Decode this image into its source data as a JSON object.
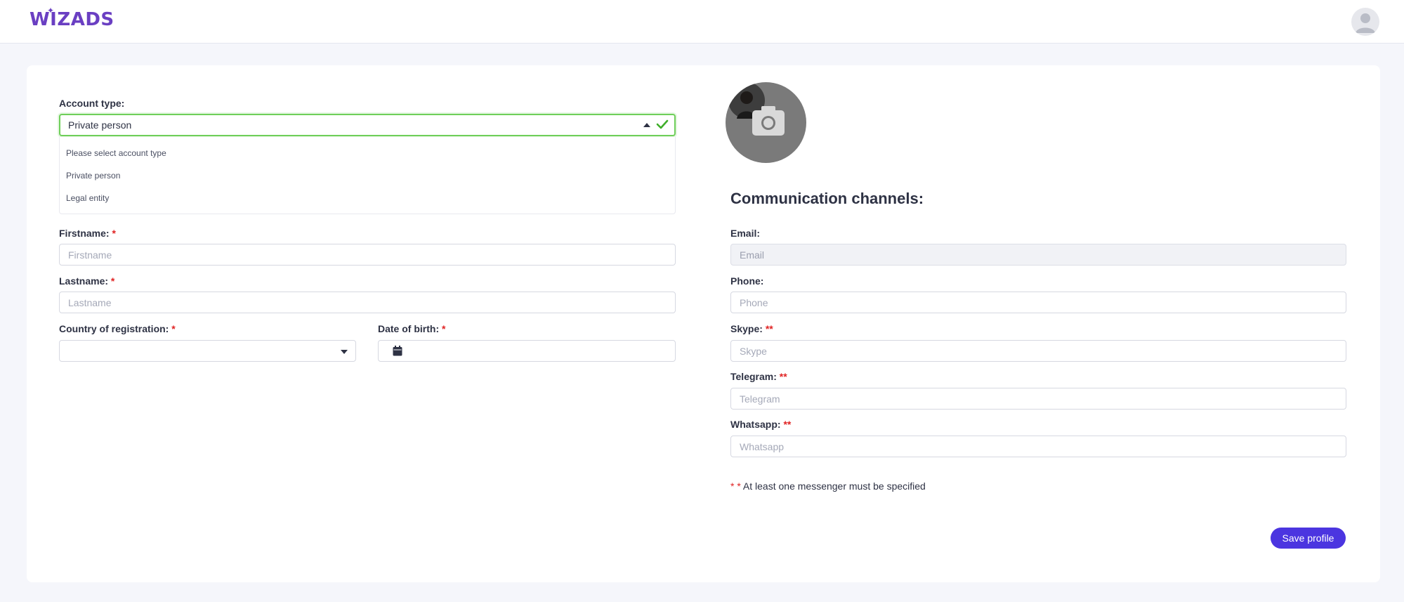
{
  "header": {
    "logo_text": "WIZADS"
  },
  "form": {
    "account_type": {
      "label": "Account type:",
      "selected": "Private person",
      "options": [
        "Please select account type",
        "Private person",
        "Legal entity"
      ]
    },
    "firstname": {
      "label": "Firstname:",
      "required": "*",
      "placeholder": "Firstname"
    },
    "lastname": {
      "label": "Lastname:",
      "required": "*",
      "placeholder": "Lastname"
    },
    "country": {
      "label": "Country of registration:",
      "required": "*"
    },
    "dob": {
      "label": "Date of birth:",
      "required": "*"
    }
  },
  "channels": {
    "title": "Communication channels:",
    "email": {
      "label": "Email:",
      "placeholder": "Email"
    },
    "phone": {
      "label": "Phone:",
      "placeholder": "Phone"
    },
    "skype": {
      "label": "Skype:",
      "required": "**",
      "placeholder": "Skype"
    },
    "telegram": {
      "label": "Telegram:",
      "required": "**",
      "placeholder": "Telegram"
    },
    "whatsapp": {
      "label": "Whatsapp:",
      "required": "**",
      "placeholder": "Whatsapp"
    },
    "note_marker": "* *",
    "note": "At least one messenger must be specified"
  },
  "actions": {
    "save_label": "Save profile"
  },
  "icons": {
    "avatar": "user-avatar-icon",
    "check": "check-icon",
    "calendar": "calendar-icon",
    "camera": "camera-icon"
  },
  "colors": {
    "brand": "#6a3fc2",
    "primary_button": "#4b35e0",
    "valid_border": "#6fcf5a",
    "required": "#e02424"
  }
}
